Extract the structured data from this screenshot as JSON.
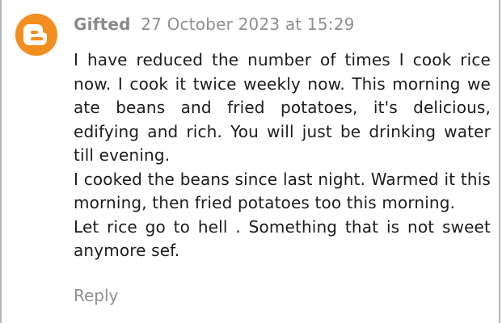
{
  "comment": {
    "author": "Gifted",
    "timestamp": "27 October 2023 at 15:29",
    "avatar_icon": "blogger-logo-icon",
    "paragraphs": [
      "I have reduced the number of times I cook rice now. I cook it twice weekly now. This morning we ate beans and fried potatoes, it's delicious, edifying and rich. You will just be drinking water till evening.",
      "I cooked the beans since last night. Warmed it this morning, then fried potatoes too this morning.",
      "Let rice go to hell . Something that is not sweet anymore sef."
    ],
    "reply_label": "Reply"
  },
  "colors": {
    "avatar_bg": "#f28e1f",
    "meta_text": "#8f8f8f",
    "body_text": "#1c1c1c",
    "frame_border": "#b5b5b5"
  }
}
